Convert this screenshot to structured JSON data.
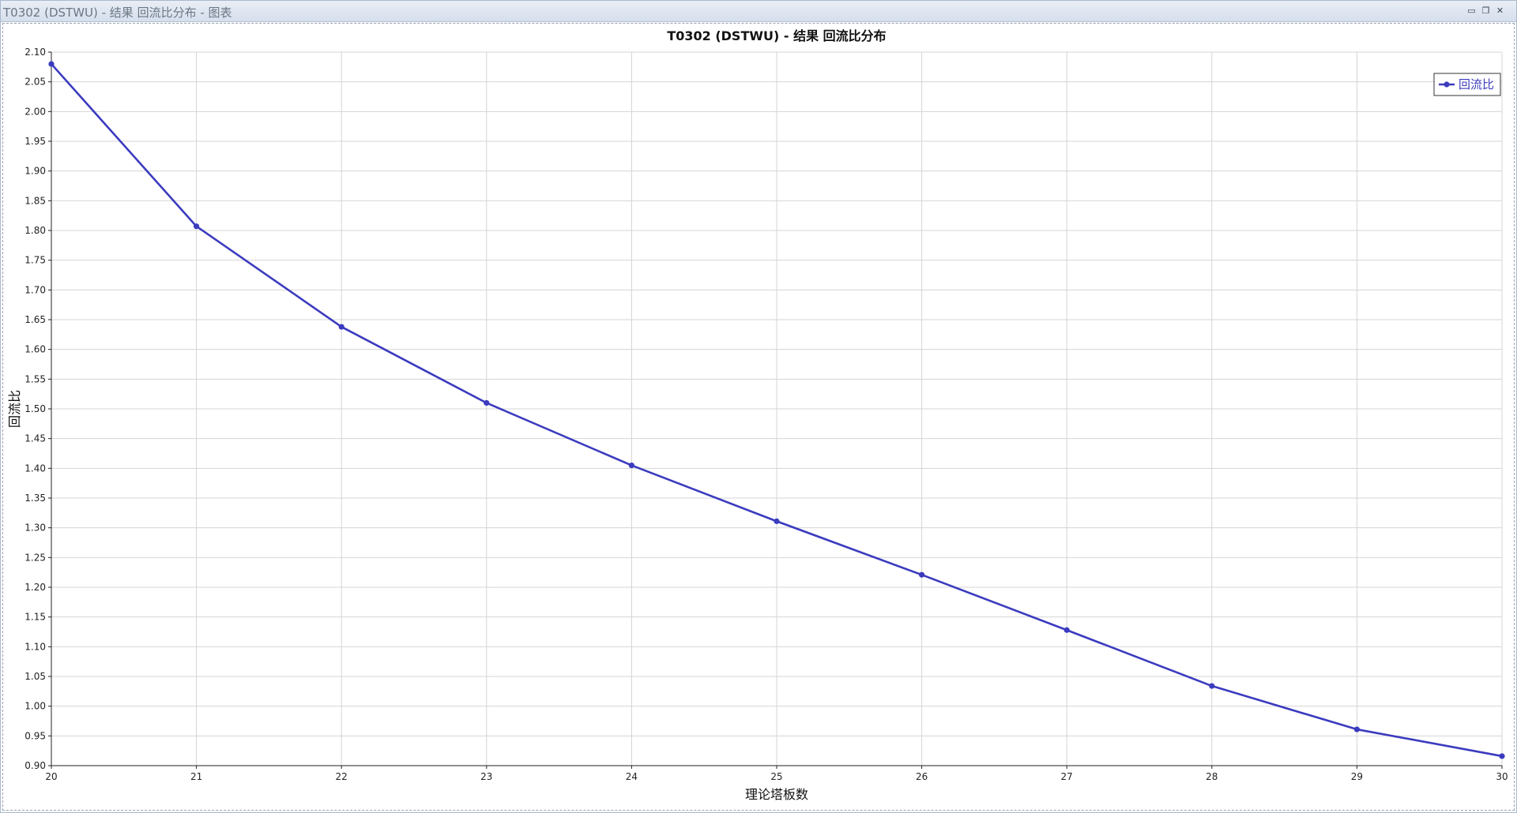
{
  "window": {
    "title": "T0302 (DSTWU) - 结果 回流比分布 - 图表",
    "minimize_glyph": "▭",
    "restore_glyph": "❐",
    "close_glyph": "✕"
  },
  "colors": {
    "series": "#3b3bbf",
    "grid": "#d4d4d4",
    "axis": "#222222"
  },
  "chart_data": {
    "type": "line",
    "title": "T0302 (DSTWU) - 结果 回流比分布",
    "xlabel": "理论塔板数",
    "ylabel": "回流比",
    "xlim": [
      20,
      30
    ],
    "ylim": [
      0.9,
      2.1
    ],
    "x_ticks": [
      "20",
      "21",
      "22",
      "23",
      "24",
      "25",
      "26",
      "27",
      "28",
      "29",
      "30"
    ],
    "y_ticks": [
      "0.90",
      "0.95",
      "1.00",
      "1.05",
      "1.10",
      "1.15",
      "1.20",
      "1.25",
      "1.30",
      "1.35",
      "1.40",
      "1.45",
      "1.50",
      "1.55",
      "1.60",
      "1.65",
      "1.70",
      "1.75",
      "1.80",
      "1.85",
      "1.90",
      "1.95",
      "2.00",
      "2.05",
      "2.10"
    ],
    "grid": true,
    "legend_position": "top-right",
    "series": [
      {
        "name": "回流比",
        "x": [
          20,
          21,
          22,
          23,
          24,
          25,
          26,
          27,
          28,
          29,
          30
        ],
        "y": [
          2.08,
          1.807,
          1.638,
          1.51,
          1.405,
          1.311,
          1.221,
          1.128,
          1.034,
          0.961,
          0.916
        ]
      }
    ]
  }
}
